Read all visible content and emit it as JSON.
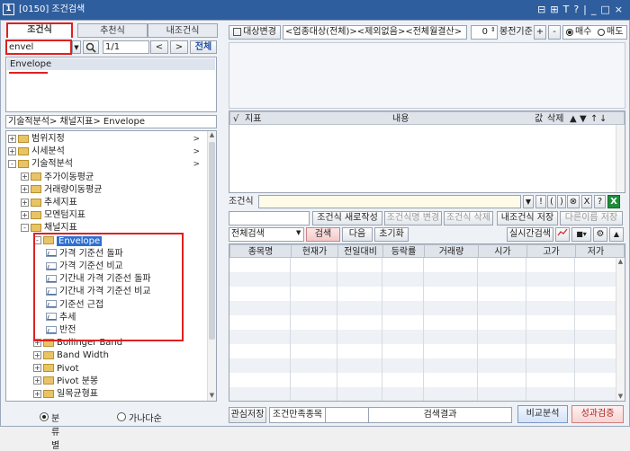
{
  "window": {
    "number": "1",
    "title": "[0150] 조건검색",
    "controls": [
      "⊟",
      "⊞",
      "T",
      "?",
      "|",
      "_",
      "□",
      "×"
    ]
  },
  "left": {
    "tabs": [
      "조건식",
      "추천식",
      "내조건식"
    ],
    "search": {
      "value": "envel",
      "page": "1/1",
      "prev": "<",
      "next": ">",
      "all": "전체"
    },
    "result_item": "Envelope",
    "breadcrumb": "기술적분석> 채널지표> Envelope",
    "tree": [
      {
        "label": "범위지정",
        "level": 0,
        "sign": "+",
        "arrow": ">"
      },
      {
        "label": "시세분석",
        "level": 0,
        "sign": "+",
        "arrow": ">"
      },
      {
        "label": "기술적분석",
        "level": 0,
        "sign": "-",
        "arrow": ">"
      },
      {
        "label": "주가이동평균",
        "level": 1,
        "sign": "+"
      },
      {
        "label": "거래량이동평균",
        "level": 1,
        "sign": "+"
      },
      {
        "label": "추세지표",
        "level": 1,
        "sign": "+"
      },
      {
        "label": "모멘텀지표",
        "level": 1,
        "sign": "+"
      },
      {
        "label": "채널지표",
        "level": 1,
        "sign": "-"
      },
      {
        "label": "Envelope",
        "level": 2,
        "sign": "-",
        "selected": true
      },
      {
        "label": "가격 기준선 돌파",
        "level": 3
      },
      {
        "label": "가격 기준선 비교",
        "level": 3
      },
      {
        "label": "기간내 가격 기준선 돌파",
        "level": 3
      },
      {
        "label": "기간내 가격 기준선 비교",
        "level": 3
      },
      {
        "label": "기준선 근접",
        "level": 3
      },
      {
        "label": "추세",
        "level": 3
      },
      {
        "label": "반전",
        "level": 3
      },
      {
        "label": "Bollinger Band",
        "level": 2,
        "sign": "+"
      },
      {
        "label": "Band Width",
        "level": 2,
        "sign": "+"
      },
      {
        "label": "Pivot",
        "level": 2,
        "sign": "+"
      },
      {
        "label": "Pivot 분봉",
        "level": 2,
        "sign": "+"
      },
      {
        "label": "일목균형표",
        "level": 2,
        "sign": "+"
      }
    ],
    "radio": {
      "option1": "분류별",
      "option2": "가나다순"
    }
  },
  "right": {
    "top": {
      "change_btn": "대상변경",
      "target": "<업종대상(전체)><제외없음><전체월결산>",
      "bong_value": "0",
      "bong_label": "봉전기준",
      "plus": "+",
      "minus": "-",
      "buy": "매수",
      "sell": "매도"
    },
    "cond_table": {
      "headers": [
        "√",
        "지표",
        "내용",
        "값",
        "삭제",
        "▲",
        "▼",
        "↑",
        "↓"
      ]
    },
    "formula_label": "조건식",
    "formula_tools": [
      "▼",
      "!",
      "(",
      ")",
      "⊗",
      "X",
      "?"
    ],
    "buttons": [
      "조건식 새로작성",
      "조건식명 변경",
      "조건식 삭제",
      "내조건식 저장",
      "다른이름 저장"
    ],
    "search_row": {
      "select": "전체검색",
      "search": "검색",
      "next": "다음",
      "reset": "초기화",
      "realtime": "실시간검색"
    },
    "result_headers": [
      "종목명",
      "현재가",
      "전일대비",
      "등락률",
      "거래량",
      "시가",
      "고가",
      "저가"
    ],
    "bottom": {
      "watch_save": "관심저장",
      "satisfied": "조건만족종목",
      "result": "검색결과",
      "compare": "비교분석",
      "perf": "성과검증"
    }
  },
  "colors": {
    "titlebar": "#2f5e9e",
    "accent_red": "#e02020",
    "selected": "#2f6fd0"
  }
}
